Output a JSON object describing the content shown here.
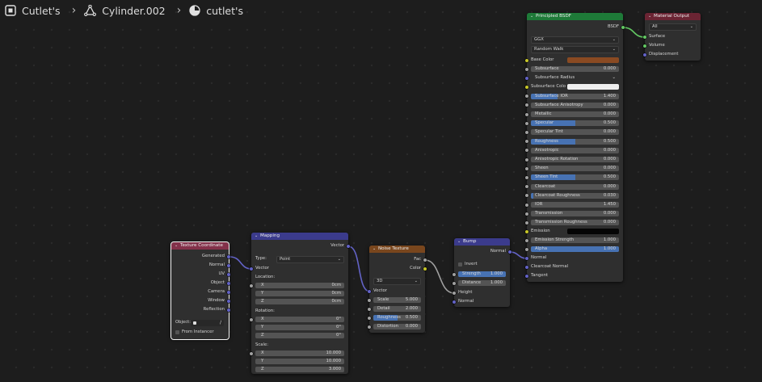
{
  "breadcrumb": {
    "object": "Cutlet's",
    "mesh": "Cylinder.002",
    "material": "cutlet's"
  },
  "nodes": {
    "texcoord": {
      "title": "Texture Coordinate",
      "outputs": [
        "Generated",
        "Normal",
        "UV",
        "Object",
        "Camera",
        "Window",
        "Reflection"
      ],
      "object_label": "Object:",
      "from_instancer": "From Instancer"
    },
    "mapping": {
      "title": "Mapping",
      "output": "Vector",
      "type_label": "Type:",
      "type_value": "Point",
      "vector_input": "Vector",
      "location_label": "Location:",
      "location": [
        {
          "axis": "X",
          "value": "0cm"
        },
        {
          "axis": "Y",
          "value": "0cm"
        },
        {
          "axis": "Z",
          "value": "0cm"
        }
      ],
      "rotation_label": "Rotation:",
      "rotation": [
        {
          "axis": "X",
          "value": "0°"
        },
        {
          "axis": "Y",
          "value": "0°"
        },
        {
          "axis": "Z",
          "value": "0°"
        }
      ],
      "scale_label": "Scale:",
      "scale": [
        {
          "axis": "X",
          "value": "10.000"
        },
        {
          "axis": "Y",
          "value": "10.000"
        },
        {
          "axis": "Z",
          "value": "3.000"
        }
      ]
    },
    "noise": {
      "title": "Noise Texture",
      "outputs": [
        "Fac",
        "Color"
      ],
      "dimension": "3D",
      "vector_input": "Vector",
      "fields": [
        {
          "label": "Scale",
          "value": "5.000",
          "fill": 0
        },
        {
          "label": "Detail",
          "value": "2.000",
          "fill": 0
        },
        {
          "label": "Roughness",
          "value": "0.500",
          "fill": 0.5
        },
        {
          "label": "Distortion",
          "value": "0.000",
          "fill": 0
        }
      ]
    },
    "bump": {
      "title": "Bump",
      "output": "Normal",
      "invert": "Invert",
      "fields": [
        {
          "label": "Strength",
          "value": "1.000",
          "fill": 1
        },
        {
          "label": "Distance",
          "value": "1.000",
          "fill": 0
        }
      ],
      "inputs": [
        "Height",
        "Normal"
      ]
    },
    "bsdf": {
      "title": "Principled BSDF",
      "output": "BSDF",
      "distribution": "GGX",
      "subsurface_method": "Random Walk",
      "base_color_label": "Base Color",
      "base_color": "#8a4a22",
      "rows": [
        {
          "label": "Subsurface",
          "value": "0.000",
          "fill": 0
        },
        {
          "label": "Subsurface Radius",
          "value": "",
          "fill": 0,
          "kind": "dropdown"
        },
        {
          "label": "Subsurface Colo",
          "value": "",
          "fill": 0,
          "kind": "color",
          "color": "#eeeeee"
        },
        {
          "label": "Subsurface IOR",
          "value": "1.400",
          "fill": 0.3
        },
        {
          "label": "Subsurface Anisotropy",
          "value": "0.000",
          "fill": 0
        },
        {
          "label": "Metallic",
          "value": "0.000",
          "fill": 0
        },
        {
          "label": "Specular",
          "value": "0.500",
          "fill": 0.5
        },
        {
          "label": "Specular Tint",
          "value": "0.000",
          "fill": 0
        },
        {
          "label": "Roughness",
          "value": "0.500",
          "fill": 0.5
        },
        {
          "label": "Anisotropic",
          "value": "0.000",
          "fill": 0
        },
        {
          "label": "Anisotropic Rotation",
          "value": "0.000",
          "fill": 0
        },
        {
          "label": "Sheen",
          "value": "0.000",
          "fill": 0
        },
        {
          "label": "Sheen Tint",
          "value": "0.500",
          "fill": 0.5
        },
        {
          "label": "Clearcoat",
          "value": "0.000",
          "fill": 0
        },
        {
          "label": "Clearcoat Roughness",
          "value": "0.030",
          "fill": 0.03
        },
        {
          "label": "IOR",
          "value": "1.450",
          "fill": 0
        },
        {
          "label": "Transmission",
          "value": "0.000",
          "fill": 0
        },
        {
          "label": "Transmission Roughness",
          "value": "0.000",
          "fill": 0
        }
      ],
      "emission_label": "Emission",
      "emission_color": "#050505",
      "emission_strength": {
        "label": "Emission Strength",
        "value": "1.000"
      },
      "alpha": {
        "label": "Alpha",
        "value": "1.000",
        "fill": 1
      },
      "inputs_bottom": [
        "Normal",
        "Clearcoat Normal",
        "Tangent"
      ]
    },
    "output": {
      "title": "Material Output",
      "target": "All",
      "inputs": [
        "Surface",
        "Volume",
        "Displacement"
      ]
    }
  },
  "colors": {
    "header_input": "#83314a",
    "header_vector": "#3b3b8c",
    "header_texture": "#79461d",
    "header_shader": "#1e7a38",
    "header_output": "#6b2433",
    "slider_fill": "#4772b3",
    "link_vector": "#6363c7",
    "link_float": "#a1a1a1"
  }
}
